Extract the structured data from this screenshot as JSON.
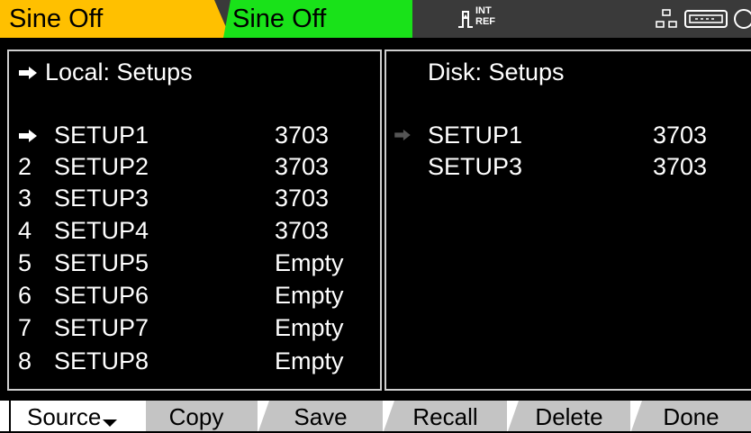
{
  "status": {
    "channel1": "Sine Off",
    "channel2": "Sine Off",
    "trigger_int": "INT",
    "trigger_ref": "REF",
    "channel1_color": "#ffc000",
    "channel2_color": "#19e219"
  },
  "local": {
    "title": "Local: Setups",
    "rows": [
      {
        "index": "",
        "selected": true,
        "name": "SETUP1",
        "value": "3703"
      },
      {
        "index": "2",
        "name": "SETUP2",
        "value": "3703"
      },
      {
        "index": "3",
        "name": "SETUP3",
        "value": "3703"
      },
      {
        "index": "4",
        "name": "SETUP4",
        "value": "3703"
      },
      {
        "index": "5",
        "name": "SETUP5",
        "value": "Empty"
      },
      {
        "index": "6",
        "name": "SETUP6",
        "value": "Empty"
      },
      {
        "index": "7",
        "name": "SETUP7",
        "value": "Empty"
      },
      {
        "index": "8",
        "name": "SETUP8",
        "value": "Empty"
      }
    ]
  },
  "disk": {
    "title": "Disk: Setups",
    "rows": [
      {
        "selected": true,
        "name": "SETUP1",
        "value": "3703"
      },
      {
        "name": "SETUP3",
        "value": "3703"
      }
    ]
  },
  "softkeys": {
    "source": "Source",
    "copy": "Copy",
    "save": "Save",
    "recall": "Recall",
    "delete": "Delete",
    "done": "Done"
  },
  "icons": [
    "trigger-icon",
    "lan-icon",
    "usb-icon",
    "clock-icon",
    "arrow-right-icon"
  ]
}
